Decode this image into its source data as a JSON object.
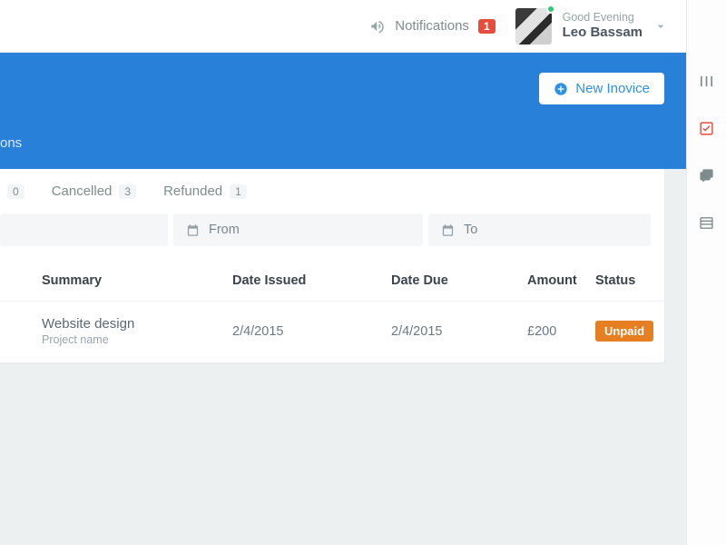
{
  "header": {
    "notifications_label": "Notifications",
    "notifications_count": "1",
    "greeting": "Good Evening",
    "user_name": "Leo Bassam"
  },
  "hero": {
    "new_invoice_label": "New Inovice",
    "breadcrumb_tail": "ons"
  },
  "tabs": [
    {
      "id": "partial",
      "label_fragment": "",
      "count": "0"
    },
    {
      "id": "cancelled",
      "label_fragment": "Cancelled",
      "count": "3"
    },
    {
      "id": "refunded",
      "label_fragment": "Refunded",
      "count": "1"
    }
  ],
  "filters": {
    "from_label": "From",
    "to_label": "To"
  },
  "table": {
    "columns": {
      "summary": "Summary",
      "date_issued": "Date Issued",
      "date_due": "Date Due",
      "amount": "Amount",
      "status": "Status"
    },
    "rows": [
      {
        "summary_main": "Website design",
        "summary_sub": "Project name",
        "date_issued": "2/4/2015",
        "date_due": "2/4/2015",
        "amount": "£200",
        "status": "Unpaid",
        "status_color": "#e67e22"
      }
    ]
  },
  "right_icons": [
    "columns-icon",
    "checkbox-icon",
    "chat-icon",
    "list-icon"
  ]
}
